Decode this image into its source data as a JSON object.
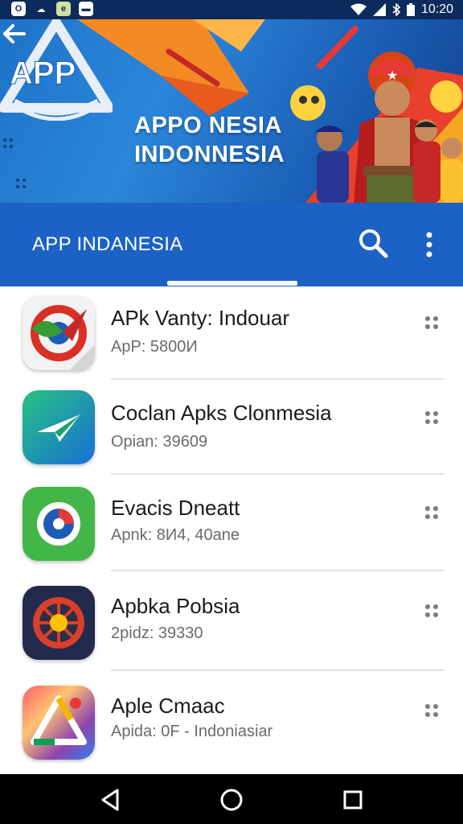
{
  "status_bar": {
    "time": "10:20",
    "notification_icons": [
      "ring-app-icon",
      "cloud-icon",
      "gallery-icon",
      "message-icon"
    ],
    "system_icons": [
      "wifi-icon",
      "cell-signal-icon",
      "bluetooth-icon",
      "battery-icon"
    ]
  },
  "banner": {
    "logo_mark_text": "APP",
    "logo_line1": "APPO NESIA",
    "logo_line2": "INDONNESIA"
  },
  "toolbar": {
    "title": "APP INDANESIA",
    "search_icon": "search-icon",
    "more_icon": "more-vertical-icon"
  },
  "apps": [
    {
      "name": "APk Vanty: Indouar",
      "meta": "ApP: 5800И"
    },
    {
      "name": "Coclan Apks Clonmesia",
      "meta": "Opian: 39609"
    },
    {
      "name": "Evacis Dneatt",
      "meta": "Apnk: 8И4, 40ane"
    },
    {
      "name": "Apbka Pobsia",
      "meta": "2pidz: 39330"
    },
    {
      "name": "Aple Cmaac",
      "meta": "Apida: 0F - Indoniasiar"
    }
  ],
  "nav_bar": {
    "icons": [
      "back-icon",
      "home-icon",
      "recents-icon"
    ]
  },
  "colors": {
    "status_bar": "#0d2a5c",
    "toolbar": "#1c62c4",
    "banner": "#2b86da",
    "nav_bar": "#000000"
  }
}
